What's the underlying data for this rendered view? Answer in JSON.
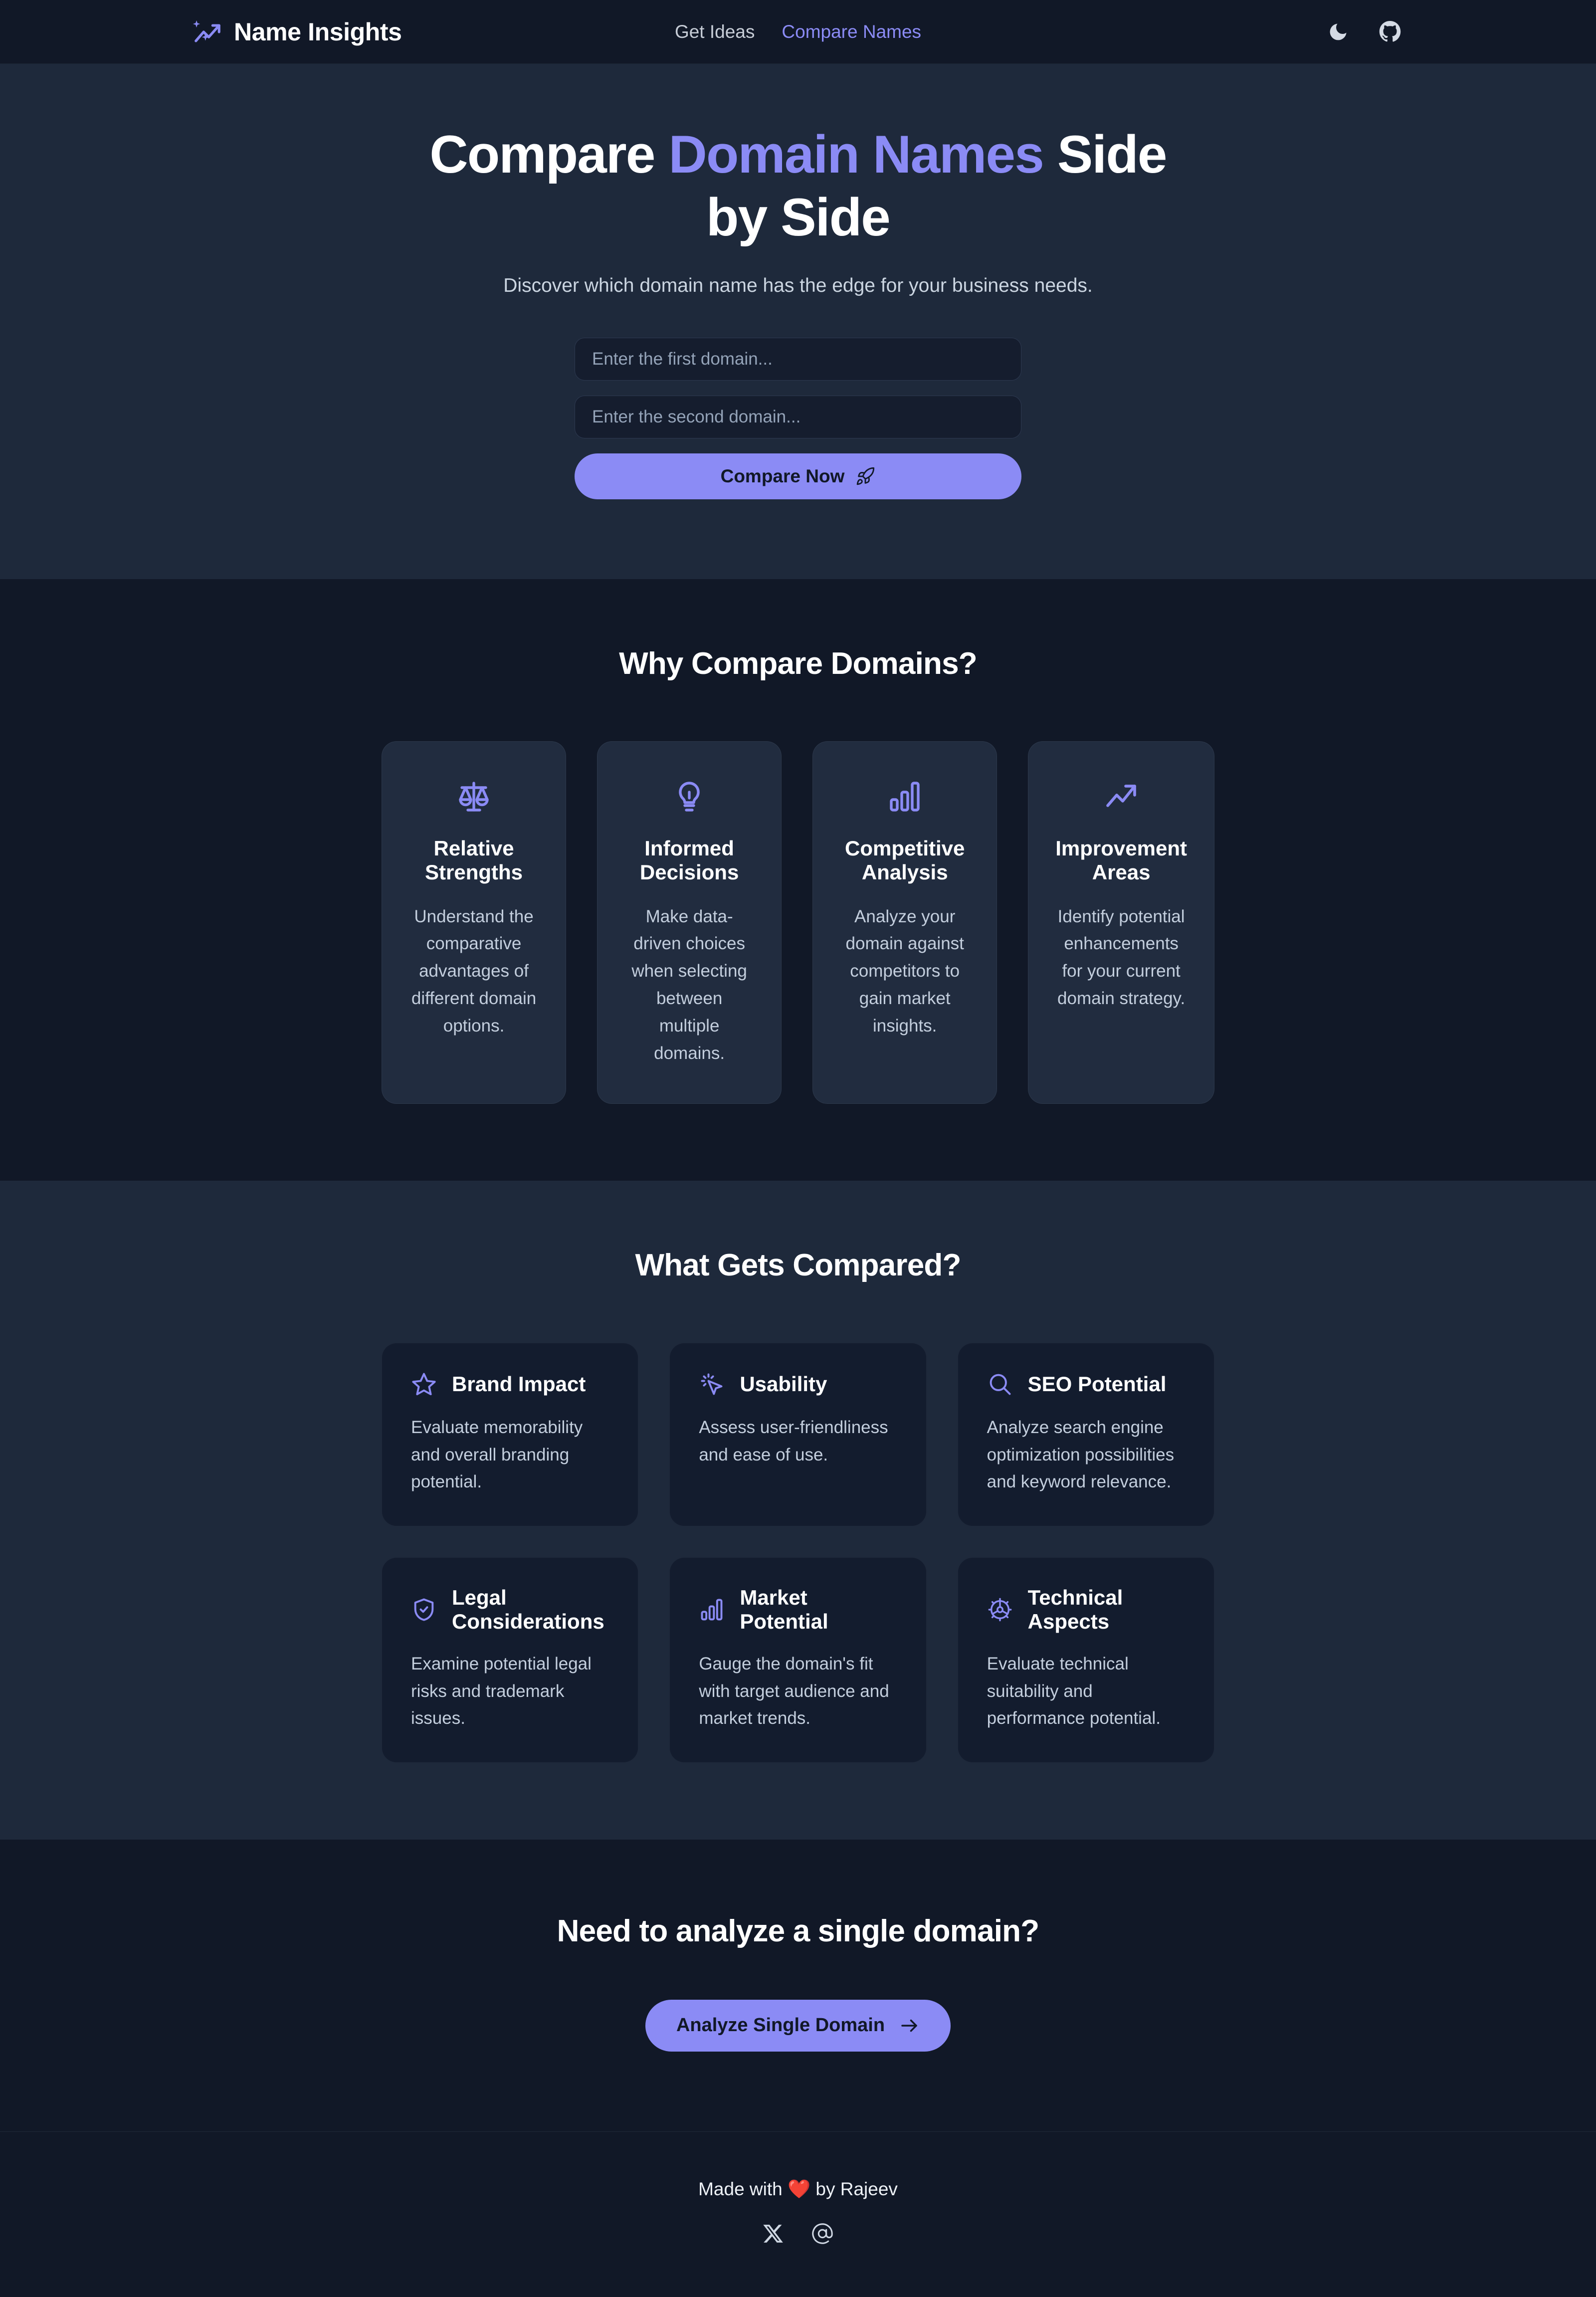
{
  "brand": {
    "name": "Name Insights",
    "logo_icon": "sparkle-trending-up-icon"
  },
  "nav": {
    "links": [
      {
        "label": "Get Ideas",
        "active": false
      },
      {
        "label": "Compare Names",
        "active": true
      }
    ],
    "actions": [
      {
        "icon": "moon-icon",
        "name": "theme-toggle"
      },
      {
        "icon": "github-icon",
        "name": "github-link"
      }
    ]
  },
  "hero": {
    "title_part1": "Compare ",
    "title_accent": "Domain Names",
    "title_part2": " Side by Side",
    "subtitle": "Discover which domain name has the edge for your business needs.",
    "input_first": {
      "value": "",
      "placeholder": "Enter the first domain..."
    },
    "input_second": {
      "value": "",
      "placeholder": "Enter the second domain..."
    },
    "submit_label": "Compare Now",
    "submit_icon": "rocket-icon"
  },
  "why": {
    "title": "Why Compare Domains?",
    "cards": [
      {
        "icon": "scales-icon",
        "title": "Relative Strengths",
        "desc": "Understand the comparative advantages of different domain options."
      },
      {
        "icon": "lightbulb-icon",
        "title": "Informed Decisions",
        "desc": "Make data-driven choices when selecting between multiple domains."
      },
      {
        "icon": "bar-chart-icon",
        "title": "Competitive Analysis",
        "desc": "Analyze your domain against competitors to gain market insights."
      },
      {
        "icon": "trending-up-icon",
        "title": "Improvement Areas",
        "desc": "Identify potential enhancements for your current domain strategy."
      }
    ]
  },
  "compared": {
    "title": "What Gets Compared?",
    "cards": [
      {
        "icon": "star-icon",
        "title": "Brand Impact",
        "desc": "Evaluate memorability and overall branding potential."
      },
      {
        "icon": "cursor-click-icon",
        "title": "Usability",
        "desc": "Assess user-friendliness and ease of use."
      },
      {
        "icon": "search-icon",
        "title": "SEO Potential",
        "desc": "Analyze search engine optimization possibilities and keyword relevance."
      },
      {
        "icon": "shield-check-icon",
        "title": "Legal Considerations",
        "desc": "Examine potential legal risks and trademark issues."
      },
      {
        "icon": "bar-chart-icon",
        "title": "Market Potential",
        "desc": "Gauge the domain's fit with target audience and market trends."
      },
      {
        "icon": "gear-icon",
        "title": "Technical Aspects",
        "desc": "Evaluate technical suitability and performance potential."
      }
    ]
  },
  "cta": {
    "title": "Need to analyze a single domain?",
    "button_label": "Analyze Single Domain",
    "button_icon": "arrow-right-icon"
  },
  "footer": {
    "made_prefix": "Made with ",
    "heart": "❤️",
    "made_suffix": " by Rajeev",
    "social": [
      {
        "icon": "x-twitter-icon",
        "name": "x-link"
      },
      {
        "icon": "at-email-icon",
        "name": "email-link"
      }
    ]
  },
  "colors": {
    "accent": "#8b8bf5",
    "bg_dark": "#111827",
    "bg_light": "#1e293b",
    "card_light": "#212c3f",
    "card_dark": "#131c2e",
    "heart": "#ef4444"
  }
}
